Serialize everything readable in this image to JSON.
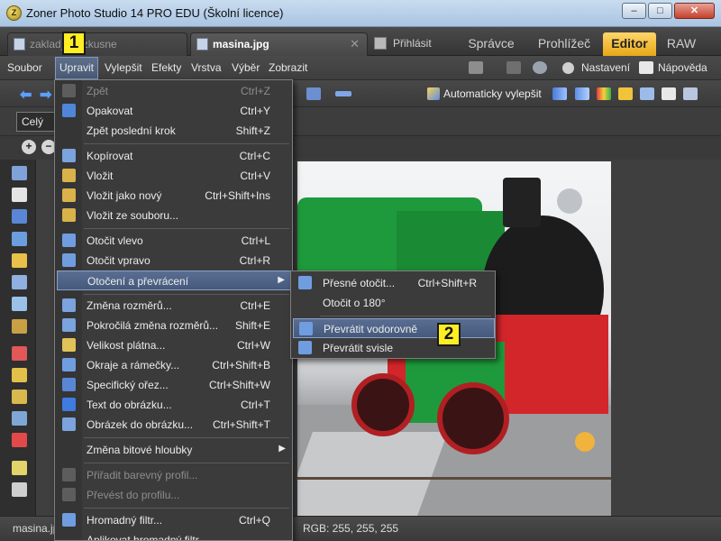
{
  "window": {
    "title": "Zoner Photo Studio 14 PRO EDU (Školní licence)",
    "app_icon_letter": "Z",
    "min_glyph": "–",
    "max_glyph": "□",
    "close_glyph": "✕"
  },
  "tabs": {
    "doc1_label": "zaklad_orezkusne",
    "doc2_label": "masina.jpg",
    "doc2_close": "✕",
    "modules": [
      "Přihlásit",
      "Správce",
      "Prohlížeč",
      "Editor",
      "RAW"
    ],
    "active_module": "Editor"
  },
  "menubar": {
    "items": [
      "Soubor",
      "Upravit",
      "Vylepšit",
      "Efekty",
      "Vrstva",
      "Výběr",
      "Zobrazit"
    ],
    "open_item": "Upravit",
    "right_settings": "Nastavení",
    "right_help": "Nápověda"
  },
  "toolbar": {
    "back_glyph": "⬅",
    "forward_glyph": "➡",
    "auto_enhance": "Automaticky vylepšit"
  },
  "toolbar2": {
    "zoom_value": "Celý"
  },
  "toolbar3": {
    "zoom_in": "+",
    "zoom_out": "−"
  },
  "status": {
    "filename": "masina.jpg",
    "rgb": "RGB: 255, 255, 255"
  },
  "edit_menu": {
    "items": [
      {
        "label": "Zpět",
        "shortcut": "Ctrl+Z",
        "disabled": true
      },
      {
        "label": "Opakovat",
        "shortcut": "Ctrl+Y"
      },
      {
        "label": "Zpět poslední krok",
        "shortcut": "Shift+Z"
      },
      {
        "label": "Kopírovat",
        "shortcut": "Ctrl+C"
      },
      {
        "label": "Vložit",
        "shortcut": "Ctrl+V"
      },
      {
        "label": "Vložit jako nový",
        "shortcut": "Ctrl+Shift+Ins"
      },
      {
        "label": "Vložit ze souboru...",
        "shortcut": ""
      },
      {
        "label": "Otočit vlevo",
        "shortcut": "Ctrl+L"
      },
      {
        "label": "Otočit vpravo",
        "shortcut": "Ctrl+R"
      },
      {
        "label": "Otočení a převrácení",
        "shortcut": "",
        "submenu": true,
        "highlighted": true
      },
      {
        "label": "Změna rozměrů...",
        "shortcut": "Ctrl+E"
      },
      {
        "label": "Pokročilá změna rozměrů...",
        "shortcut": "Shift+E"
      },
      {
        "label": "Velikost plátna...",
        "shortcut": "Ctrl+W"
      },
      {
        "label": "Okraje a rámečky...",
        "shortcut": "Ctrl+Shift+B"
      },
      {
        "label": "Specifický ořez...",
        "shortcut": "Ctrl+Shift+W"
      },
      {
        "label": "Text do obrázku...",
        "shortcut": "Ctrl+T"
      },
      {
        "label": "Obrázek do obrázku...",
        "shortcut": "Ctrl+Shift+T"
      },
      {
        "label": "Změna bitové hloubky",
        "shortcut": "",
        "submenu": true
      },
      {
        "label": "Přiřadit barevný profil...",
        "shortcut": "",
        "disabled": true
      },
      {
        "label": "Převést do profilu...",
        "shortcut": "",
        "disabled": true
      },
      {
        "label": "Hromadný filtr...",
        "shortcut": "Ctrl+Q"
      },
      {
        "label": "Aplikovat hromadný filtr",
        "shortcut": ""
      }
    ],
    "submenu_arrow": "▶"
  },
  "rotate_submenu": {
    "items": [
      {
        "label": "Přesné otočit...",
        "shortcut": "Ctrl+Shift+R"
      },
      {
        "label": "Otočit o 180°",
        "shortcut": ""
      },
      {
        "label": "Převrátit vodorovně",
        "shortcut": "",
        "highlighted": true
      },
      {
        "label": "Převrátit svisle",
        "shortcut": ""
      }
    ]
  },
  "callouts": {
    "first": "1",
    "second": "2"
  },
  "colors": {
    "editor_tab": "#f2b92c",
    "menu_highlight": "#4f6386",
    "callout_fill": "#ffee22",
    "locomotive_red": "#d3262a",
    "locomotive_green": "#1e9a3c"
  }
}
